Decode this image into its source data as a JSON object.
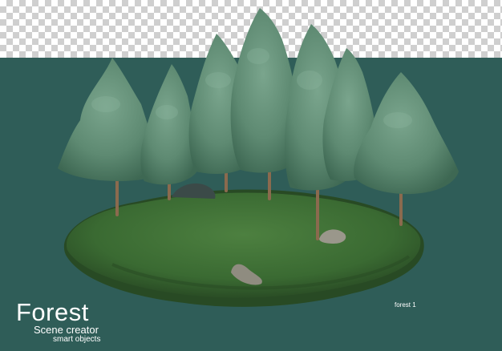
{
  "colors": {
    "background_teal": "#2f5d58",
    "checker_light": "#ffffff",
    "checker_dark": "#cfcfcf",
    "grass": "#3f6f35",
    "grass_dark": "#2a4d25",
    "foliage": "#5e8a72",
    "foliage_dark": "#3e6853",
    "trunk": "#8b6a4e",
    "rock": "#9a978b",
    "text": "#ffffff"
  },
  "branding": {
    "title": "Forest",
    "subtitle": "Scene creator",
    "tagline": "smart objects"
  },
  "caption": "forest 1"
}
